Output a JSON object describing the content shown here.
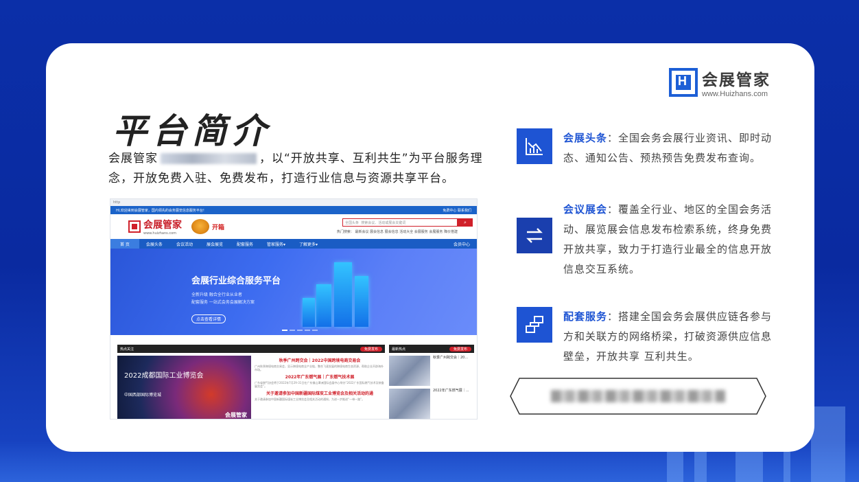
{
  "slide": {
    "title": "平台简介",
    "intro_prefix": "会展管家",
    "intro_rest": "，以“开放共享、互利共生”为平台服务理念，开放免费入驻、免费发布，打造行业信息与资源共享平台。"
  },
  "brand": {
    "name": "会展管家",
    "url": "www.Huizhans.com",
    "mark": "H",
    "color": "#1d5fd6"
  },
  "features": [
    {
      "key": "会展头条",
      "text": "：全国会务会展行业资讯、即时动态、通知公告、预热预告免费发布查询。",
      "icon": "chart-icon"
    },
    {
      "key": "会议展会",
      "text": "：覆盖全行业、地区的全国会务活动、展览展会信息发布检索系统，终身免费开放共享，致力于打造行业最全的信息开放信息交互系统。",
      "icon": "exchange-icon"
    },
    {
      "key": "配套服务",
      "text": "：搭建全国会务会展供应链各参与方和关联方的网络桥梁，打破资源供应信息壁垒，开放共享 互利共生。",
      "icon": "network-icon"
    }
  ],
  "screenshot": {
    "browser_url": "http",
    "topbar_notice": "HI,欢迎来到会展管家，国内领先的会务展览信息服务平台!",
    "topbar_right": "免费中心    联系我们",
    "site_name": "会展管家",
    "site_url": "www.huizhans.com",
    "kaiyun": "开箱",
    "search_scope": "全国头条",
    "search_placeholder": "搜索会议、活动或展会关键词",
    "hot_search": "热门搜索：  最新会议  展会信息  展会信息  活动大全  会展服务  会展服务  降价搭建",
    "nav": [
      "首 页",
      "会展头条",
      "会议活动",
      "展会展览",
      "配套服务",
      "管家服务▾",
      "了解更多▾"
    ],
    "nav_right": "会员中心",
    "banner_title": "会展行业综合服务平台",
    "banner_sub1": "全新升级   融合全行业从业者",
    "banner_sub2": "配套服务   一站式会务会展解决方案",
    "banner_btn": "点击查看详情",
    "news_head": "热点关注",
    "news_btn": "免费发布",
    "expo_title": "2022成都国际工业博览会",
    "expo_sub": "中国西部国际博览城",
    "expo_brand": "会展管家",
    "news_items": [
      {
        "h": "秋季广州跨交会｜2022中国跨境电商交易会",
        "p": "广州秋季跨境电商交易会，显示跨境电商全产业链，整合飞速发展的跨境电商生态资源，帮助企业开辟海外市场。"
      },
      {
        "h": "2022年广东燃气展｜广东燃气技术展",
        "p": "广东省燃气协会将于2022年7月29-31日在广东佛山潭洲国际会展中心举办“2022广东国际燃气技术及装备展览会”。"
      },
      {
        "h": "关于邀请参加中国新疆国际煤炭工业博览会及相关活动的通",
        "p": "关于邀请参加中国新疆国际煤炭工业博览会及相关活动的通知，为进一步推进“一带一路”。"
      }
    ],
    "side_head": "最新热点",
    "side_items": [
      "秋季广州跨交会｜20...",
      "2022年广东燃气展｜..."
    ]
  }
}
